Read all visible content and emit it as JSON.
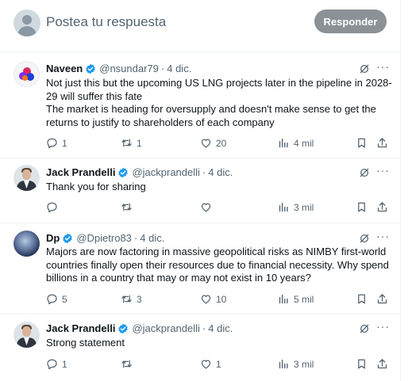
{
  "composer": {
    "placeholder": "Postea tu respuesta",
    "reply_label": "Responder"
  },
  "posts": [
    {
      "name": "Naveen",
      "handle": "@nsundar79",
      "date": "4 dic.",
      "lines": [
        "Not just this but the upcoming US LNG projects later in the pipeline in 2028-",
        "29 will suffer this fate",
        "The market is heading for oversupply and doesn't make sense to get the",
        "returns to justify to shareholders of each company"
      ],
      "replies": "1",
      "reposts": "1",
      "likes": "20",
      "views": "4 mil"
    },
    {
      "name": "Jack Prandelli",
      "handle": "@jackprandelli",
      "date": "4 dic.",
      "lines": [
        "Thank you for sharing"
      ],
      "replies": "",
      "reposts": "",
      "likes": "",
      "views": "3 mil"
    },
    {
      "name": "Dp",
      "handle": "@Dpietro83",
      "date": "4 dic.",
      "lines": [
        "Majors are now factoring in massive geopolitical risks as NIMBY first-world",
        "countries finally open their resources due to financial necessity. Why spend",
        "billions in a country that may or may not exist in 10 years?"
      ],
      "replies": "5",
      "reposts": "3",
      "likes": "10",
      "views": "5 mil"
    },
    {
      "name": "Jack Prandelli",
      "handle": "@jackprandelli",
      "date": "4 dic.",
      "lines": [
        "Strong statement"
      ],
      "replies": "1",
      "reposts": "",
      "likes": "1",
      "views": "3 mil"
    }
  ],
  "colors": {
    "accent": "#1d9bf0",
    "muted": "#536471",
    "button": "#8b9195"
  },
  "icons": [
    "reply-icon",
    "repost-icon",
    "like-icon",
    "views-icon",
    "bookmark-icon",
    "share-icon",
    "grok-icon",
    "more-icon",
    "verified-badge-icon"
  ]
}
